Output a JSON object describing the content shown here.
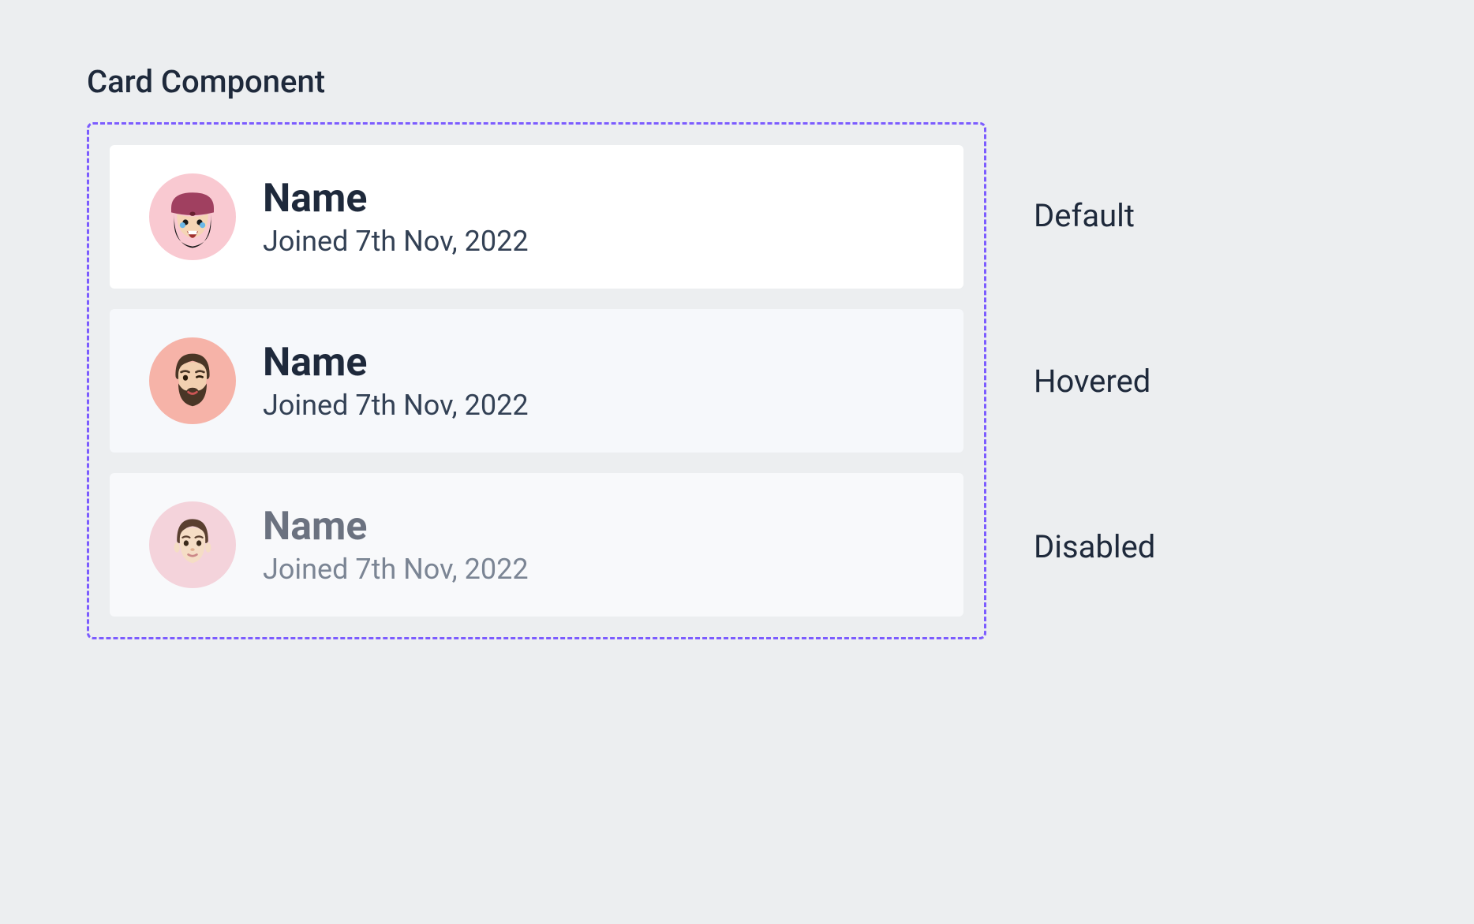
{
  "section_title": "Card Component",
  "cards": [
    {
      "state": "default",
      "state_label": "Default",
      "name": "Name",
      "subtitle": "Joined 7th Nov, 2022",
      "avatar_icon": "memoji-hat"
    },
    {
      "state": "hovered",
      "state_label": "Hovered",
      "name": "Name",
      "subtitle": "Joined 7th Nov, 2022",
      "avatar_icon": "memoji-beard"
    },
    {
      "state": "disabled",
      "state_label": "Disabled",
      "name": "Name",
      "subtitle": "Joined 7th Nov, 2022",
      "avatar_icon": "memoji-plain"
    }
  ],
  "colors": {
    "frame_border": "#7c5cff",
    "text_primary": "#1e293b",
    "text_secondary": "#334155",
    "text_disabled": "#6b7280",
    "bg_page": "#eceef0",
    "bg_card_default": "#ffffff",
    "bg_card_hovered": "#f6f8fb",
    "bg_card_disabled": "#f8f9fb",
    "avatar_bg_default": "#f9c9d1",
    "avatar_bg_hovered": "#f6b3a8",
    "avatar_bg_disabled": "#f4d3db"
  }
}
